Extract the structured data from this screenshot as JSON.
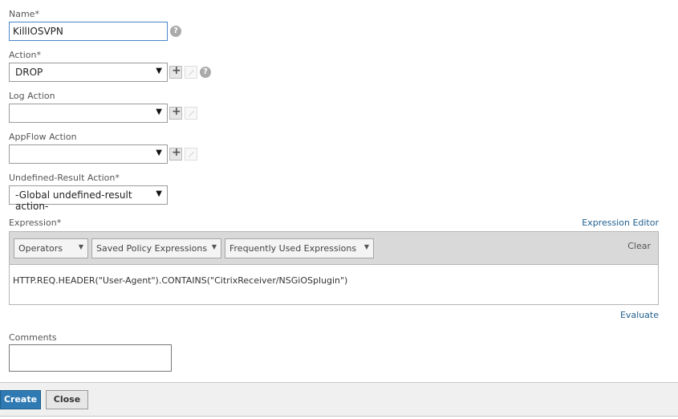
{
  "form": {
    "name": {
      "label": "Name*",
      "value": "KillIOSVPN"
    },
    "action": {
      "label": "Action*",
      "value": "DROP"
    },
    "log_action": {
      "label": "Log Action",
      "value": ""
    },
    "appflow_action": {
      "label": "AppFlow Action",
      "value": ""
    },
    "undefined_result": {
      "label": "Undefined-Result Action*",
      "value": "-Global undefined-result action-"
    },
    "expression": {
      "label": "Expression*",
      "editor_link": "Expression Editor",
      "operators": "Operators",
      "saved": "Saved Policy Expressions",
      "frequent": "Frequently Used Expressions",
      "clear": "Clear",
      "value": "HTTP.REQ.HEADER(\"User-Agent\").CONTAINS(\"CitrixReceiver/NSGiOSplugin\")",
      "evaluate": "Evaluate"
    },
    "comments": {
      "label": "Comments",
      "value": ""
    }
  },
  "footer": {
    "create": "Create",
    "close": "Close"
  },
  "icons": {
    "help": "?",
    "dropdown": "▼",
    "caret": "▼"
  }
}
